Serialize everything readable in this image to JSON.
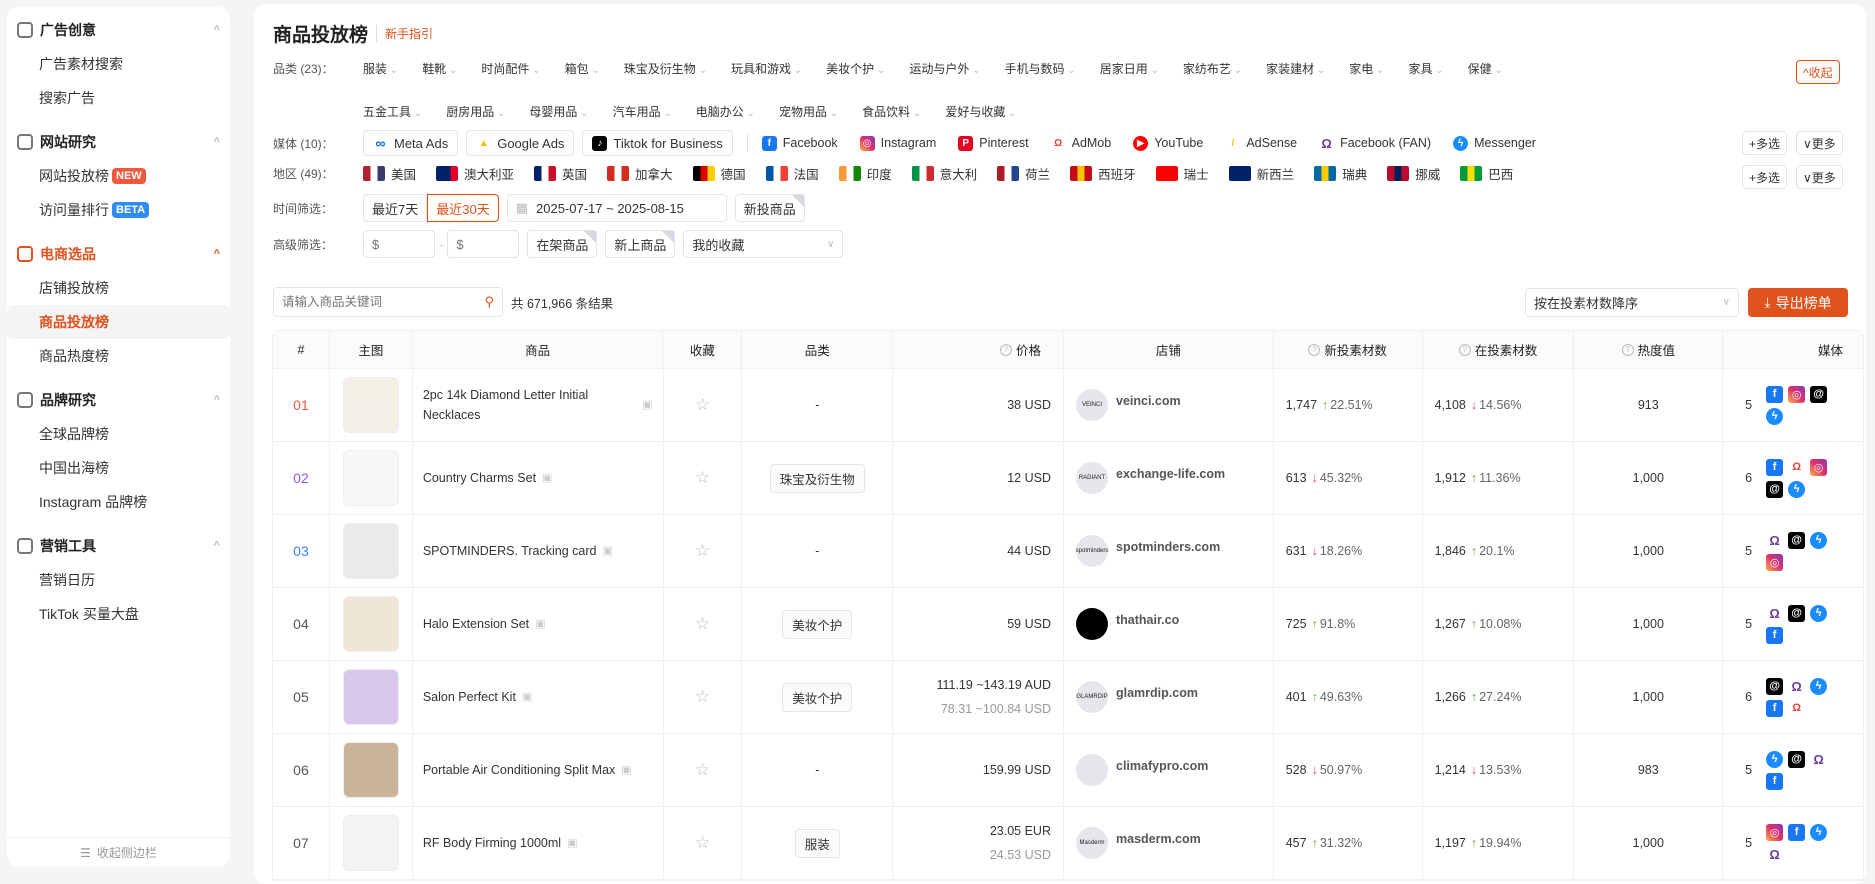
{
  "sidebar": {
    "groups": [
      {
        "title": "广告创意",
        "icon": "ad-creative-icon",
        "items": [
          {
            "label": "广告素材搜索"
          },
          {
            "label": "搜索广告"
          }
        ]
      },
      {
        "title": "网站研究",
        "icon": "compass-icon",
        "items": [
          {
            "label": "网站投放榜",
            "badge": "NEW",
            "badge_color": "#f2583e"
          },
          {
            "label": "访问量排行",
            "badge": "BETA",
            "badge_color": "#2f8cf5"
          }
        ]
      },
      {
        "title": "电商选品",
        "icon": "cart-icon",
        "active": true,
        "items": [
          {
            "label": "店铺投放榜"
          },
          {
            "label": "商品投放榜",
            "active": true
          },
          {
            "label": "商品热度榜"
          }
        ]
      },
      {
        "title": "品牌研究",
        "icon": "brand-icon",
        "items": [
          {
            "label": "全球品牌榜"
          },
          {
            "label": "中国出海榜"
          },
          {
            "label": "Instagram 品牌榜"
          }
        ]
      },
      {
        "title": "营销工具",
        "icon": "broadcast-icon",
        "items": [
          {
            "label": "营销日历"
          },
          {
            "label": "TikTok 买量大盘"
          }
        ]
      }
    ],
    "collapse_label": "收起侧边栏"
  },
  "header": {
    "title": "商品投放榜",
    "guide": "新手指引"
  },
  "filters": {
    "category_label": "品类 (23)：",
    "categories": [
      "服装",
      "鞋靴",
      "时尚配件",
      "箱包",
      "珠宝及衍生物",
      "玩具和游戏",
      "美妆个护",
      "运动与户外",
      "手机与数码",
      "居家日用",
      "家纺布艺",
      "家装建材",
      "家电",
      "家具",
      "保健",
      "五金工具",
      "厨房用品",
      "母婴用品",
      "汽车用品",
      "电脑办公",
      "宠物用品",
      "食品饮料",
      "爱好与收藏"
    ],
    "collapse": "^收起",
    "media_label": "媒体 (10)：",
    "media_chips": [
      {
        "label": "Meta Ads",
        "icon": "meta",
        "color": "#0a66e8"
      },
      {
        "label": "Google Ads",
        "icon": "google-ads",
        "color": "#fbbc04"
      },
      {
        "label": "Tiktok for Business",
        "icon": "tiktok",
        "color": "#000000"
      }
    ],
    "media": [
      {
        "label": "Facebook",
        "icon": "fb"
      },
      {
        "label": "Instagram",
        "icon": "ig"
      },
      {
        "label": "Pinterest",
        "icon": "pinterest"
      },
      {
        "label": "AdMob",
        "icon": "admob"
      },
      {
        "label": "YouTube",
        "icon": "youtube"
      },
      {
        "label": "AdSense",
        "icon": "adsense"
      },
      {
        "label": "Facebook (FAN)",
        "icon": "fan"
      },
      {
        "label": "Messenger",
        "icon": "messenger"
      }
    ],
    "multi": "+多选",
    "more": "∨更多",
    "region_label": "地区 (49)：",
    "regions": [
      {
        "label": "美国",
        "c": [
          "#b22234",
          "#ffffff",
          "#3c3b6e"
        ]
      },
      {
        "label": "澳大利亚",
        "c": [
          "#012169",
          "#012169",
          "#e4002b"
        ]
      },
      {
        "label": "英国",
        "c": [
          "#012169",
          "#ffffff",
          "#c8102e"
        ]
      },
      {
        "label": "加拿大",
        "c": [
          "#d52b1e",
          "#ffffff",
          "#d52b1e"
        ]
      },
      {
        "label": "德国",
        "c": [
          "#000000",
          "#dd0000",
          "#ffce00"
        ]
      },
      {
        "label": "法国",
        "c": [
          "#0055a4",
          "#ffffff",
          "#ef4135"
        ]
      },
      {
        "label": "印度",
        "c": [
          "#ff9933",
          "#ffffff",
          "#138808"
        ]
      },
      {
        "label": "意大利",
        "c": [
          "#009246",
          "#ffffff",
          "#ce2b37"
        ]
      },
      {
        "label": "荷兰",
        "c": [
          "#ae1c28",
          "#ffffff",
          "#21468b"
        ]
      },
      {
        "label": "西班牙",
        "c": [
          "#c60b1e",
          "#ffc400",
          "#c60b1e"
        ]
      },
      {
        "label": "瑞士",
        "c": [
          "#ff0000",
          "#ff0000",
          "#ff0000"
        ]
      },
      {
        "label": "新西兰",
        "c": [
          "#012169",
          "#012169",
          "#012169"
        ]
      },
      {
        "label": "瑞典",
        "c": [
          "#006aa7",
          "#fecc00",
          "#006aa7"
        ]
      },
      {
        "label": "挪威",
        "c": [
          "#ba0c2f",
          "#00205b",
          "#ba0c2f"
        ]
      },
      {
        "label": "巴西",
        "c": [
          "#009c3b",
          "#ffdf00",
          "#009c3b"
        ]
      }
    ],
    "time_label": "时间筛选：",
    "time_7": "最近7天",
    "time_30": "最近30天",
    "date_range": "2025-07-17 ~ 2025-08-15",
    "new_products": "新投商品",
    "adv_label": "高级筛选：",
    "price_min_placeholder": "$",
    "price_max_placeholder": "$",
    "on_shelf": "在架商品",
    "new_listed": "新上商品",
    "favorites": "我的收藏"
  },
  "toolbar": {
    "search_placeholder": "请输入商品关键词",
    "result_count": "共 671,966 条结果",
    "sort": "按在投素材数降序",
    "export": "导出榜单"
  },
  "table": {
    "columns": [
      "#",
      "主图",
      "商品",
      "收藏",
      "品类",
      "价格",
      "店铺",
      "新投素材数",
      "在投素材数",
      "热度值",
      "媒体"
    ],
    "rows": [
      {
        "rank": "01",
        "rank_color": "#f2583e",
        "img": "#f3efe6",
        "name": "2pc 14k Diamond Letter Initial Necklaces",
        "category": "-",
        "price": "38 USD",
        "price2": "",
        "store": "veinci.com",
        "logo": "VEINCI",
        "new": "1,747",
        "new_dir": "up",
        "new_pct": "22.51%",
        "live": "4,108",
        "live_dir": "dn",
        "live_pct": "14.56%",
        "heat": "913",
        "media_count": "5",
        "media": [
          "fb",
          "ig",
          "threads",
          "messenger"
        ]
      },
      {
        "rank": "02",
        "rank_color": "#8c5cf0",
        "img": "#f7f7fa",
        "name": "Country Charms Set",
        "category": "珠宝及衍生物",
        "price": "12 USD",
        "price2": "",
        "store": "exchange-life.com",
        "logo": "RADIANT",
        "new": "613",
        "new_dir": "dn",
        "new_pct": "45.32%",
        "live": "1,912",
        "live_dir": "up",
        "live_pct": "11.36%",
        "heat": "1,000",
        "media_count": "6",
        "media": [
          "fb",
          "admob",
          "ig",
          "threads",
          "messenger"
        ]
      },
      {
        "rank": "03",
        "rank_color": "#3b82f6",
        "img": "#e9eaec",
        "name": "SPOTMINDERS. Tracking card",
        "category": "-",
        "price": "44 USD",
        "price2": "",
        "store": "spotminders.com",
        "logo": "spotminders",
        "new": "631",
        "new_dir": "dn",
        "new_pct": "18.26%",
        "live": "1,846",
        "live_dir": "up",
        "live_pct": "20.1%",
        "heat": "1,000",
        "media_count": "5",
        "media": [
          "fan",
          "threads",
          "messenger",
          "ig"
        ]
      },
      {
        "rank": "04",
        "rank_color": "#555555",
        "img": "#efe6d8",
        "name": "Halo Extension Set",
        "category": "美妆个护",
        "price": "59 USD",
        "price2": "",
        "store": "thathair.co",
        "logo": "",
        "logo_dark": true,
        "new": "725",
        "new_dir": "up",
        "new_pct": "91.8%",
        "live": "1,267",
        "live_dir": "up",
        "live_pct": "10.08%",
        "heat": "1,000",
        "media_count": "5",
        "media": [
          "fan",
          "threads",
          "messenger",
          "fb"
        ]
      },
      {
        "rank": "05",
        "rank_color": "#555555",
        "img": "#d9c8ee",
        "name": "Salon Perfect Kit",
        "category": "美妆个护",
        "price": "111.19 ~143.19 AUD",
        "price2": "78.31 ~100.84 USD",
        "store": "glamrdip.com",
        "logo": "GLAMRDIP",
        "new": "401",
        "new_dir": "up",
        "new_pct": "49.63%",
        "live": "1,266",
        "live_dir": "up",
        "live_pct": "27.24%",
        "heat": "1,000",
        "media_count": "6",
        "media": [
          "threads",
          "fan",
          "messenger",
          "fb",
          "admob"
        ]
      },
      {
        "rank": "06",
        "rank_color": "#555555",
        "img": "#c9b49a",
        "name": "Portable Air Conditioning Split Max",
        "category": "-",
        "price": "159.99 USD",
        "price2": "",
        "store": "climafypro.com",
        "logo": "",
        "new": "528",
        "new_dir": "dn",
        "new_pct": "50.97%",
        "live": "1,214",
        "live_dir": "dn",
        "live_pct": "13.53%",
        "heat": "983",
        "media_count": "5",
        "media": [
          "messenger",
          "threads",
          "fan",
          "fb"
        ]
      },
      {
        "rank": "07",
        "rank_color": "#555555",
        "img": "#f4f4f4",
        "name": "RF Body Firming 1000ml",
        "category": "服装",
        "price": "23.05 EUR",
        "price2": "24.53 USD",
        "store": "masderm.com",
        "logo": "Masderm",
        "new": "457",
        "new_dir": "up",
        "new_pct": "31.32%",
        "live": "1,197",
        "live_dir": "up",
        "live_pct": "19.94%",
        "heat": "1,000",
        "media_count": "5",
        "media": [
          "ig",
          "fb",
          "messenger",
          "fan"
        ]
      }
    ]
  },
  "colors": {
    "accent": "#e0521c",
    "up": "#5cb531",
    "down": "#f03c5a"
  }
}
